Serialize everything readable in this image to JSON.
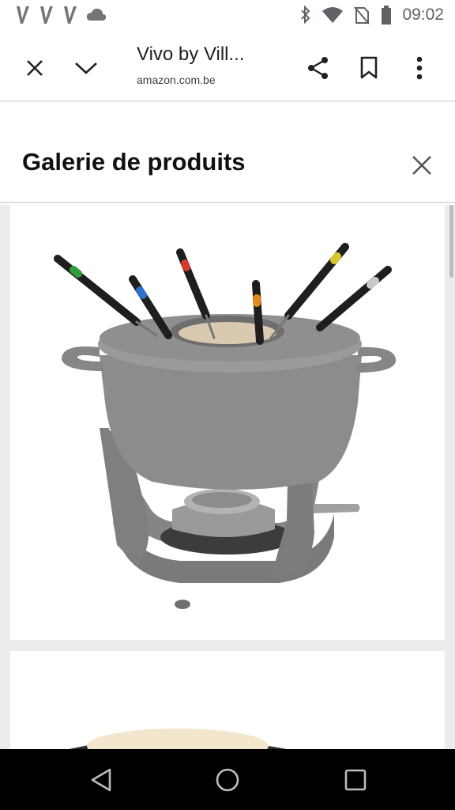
{
  "status_bar": {
    "time": "09:02",
    "left_icons": [
      "vivino-icon",
      "vivino-icon",
      "vivino-icon",
      "cloud-icon"
    ],
    "right_icons": [
      "bluetooth-icon",
      "wifi-icon",
      "no-sim-icon",
      "battery-icon"
    ]
  },
  "toolbar": {
    "title": "Vivo by Vill...",
    "url": "amazon.com.be"
  },
  "gallery": {
    "title": "Galerie de produits"
  },
  "colors": {
    "pot_grey": "#8c8c8c",
    "fork_dark": "#1e1e1e",
    "toolbar_icon": "#202124"
  }
}
